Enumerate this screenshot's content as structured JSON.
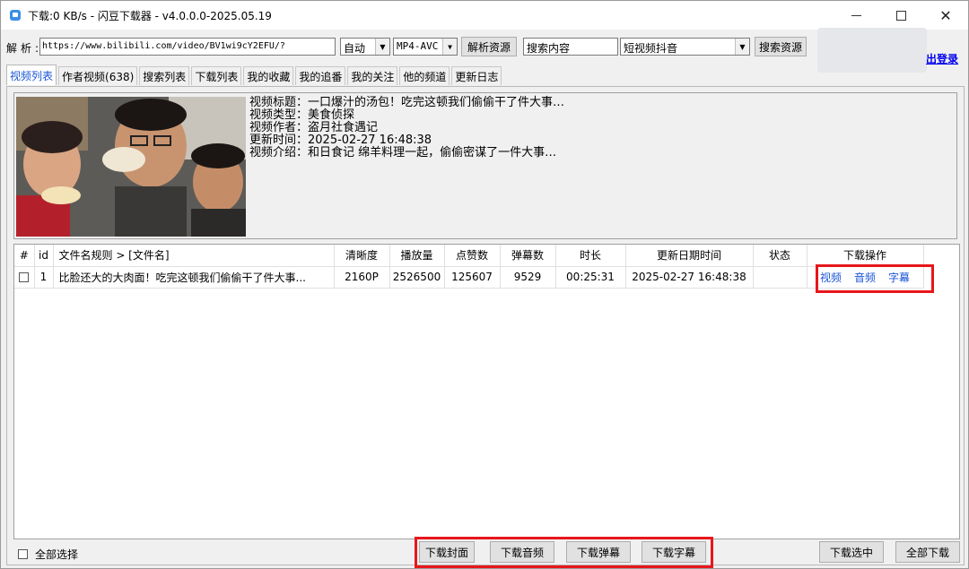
{
  "window": {
    "title": "下载:0 KB/s - 闪豆下载器 - v4.0.0.0-2025.05.19",
    "minimize": "minimize",
    "maximize": "maximize",
    "close": "✕"
  },
  "parse": {
    "label": "解析:",
    "url": "https://www.bilibili.com/video/BV1wi9cY2EFU/?",
    "quality_selected": "自动",
    "format_selected": "MP4-AVC",
    "parse_button": "解析资源",
    "search_value": "搜索内容",
    "platform_selected": "短视频抖音",
    "search_button": "搜索资源",
    "login_text": "出登录"
  },
  "tabs": [
    {
      "label": "视频列表",
      "active": true
    },
    {
      "label": "作者视频(638)",
      "active": false
    },
    {
      "label": "搜索列表",
      "active": false
    },
    {
      "label": "下载列表",
      "active": false
    },
    {
      "label": "我的收藏",
      "active": false
    },
    {
      "label": "我的追番",
      "active": false
    },
    {
      "label": "我的关注",
      "active": false
    },
    {
      "label": "他的频道",
      "active": false
    },
    {
      "label": "更新日志",
      "active": false
    }
  ],
  "video_info": {
    "title_line": "视频标题：一口爆汁的汤包！吃完这顿我们偷偷干了件大事…",
    "type_line": "视频类型：美食侦探",
    "author_line": "视频作者：盗月社食遇记",
    "updated_line": "更新时间：2025-02-27 16:48:38",
    "intro_line": "视频介绍：和日食记 绵羊料理一起，偷偷密谋了一件大事…"
  },
  "table": {
    "headers": [
      "#",
      "id",
      "文件名规则  >  [文件名]",
      "清晰度",
      "播放量",
      "点赞数",
      "弹幕数",
      "时长",
      "更新日期时间",
      "状态",
      "下载操作"
    ],
    "rows": [
      {
        "checked": false,
        "id": "1",
        "filename": "比脸还大的大肉面！吃完这顿我们偷偷干了件大事...",
        "resolution": "2160P",
        "views": "2526500",
        "likes": "125607",
        "danmaku": "9529",
        "duration": "00:25:31",
        "updated": "2025-02-27 16:48:38",
        "status": "",
        "actions": [
          "视频",
          "音频",
          "字幕"
        ]
      }
    ]
  },
  "bottom": {
    "select_all": "全部选择",
    "download_cover": "下载封面",
    "download_audio": "下载音频",
    "download_danmaku": "下载弹幕",
    "download_subtitle": "下载字幕",
    "download_selected": "下载选中",
    "download_all": "全部下载"
  },
  "colors": {
    "highlight_box": "#e8161b",
    "link_blue": "#1a56d6",
    "active_tab_text": "#1a56d6"
  }
}
